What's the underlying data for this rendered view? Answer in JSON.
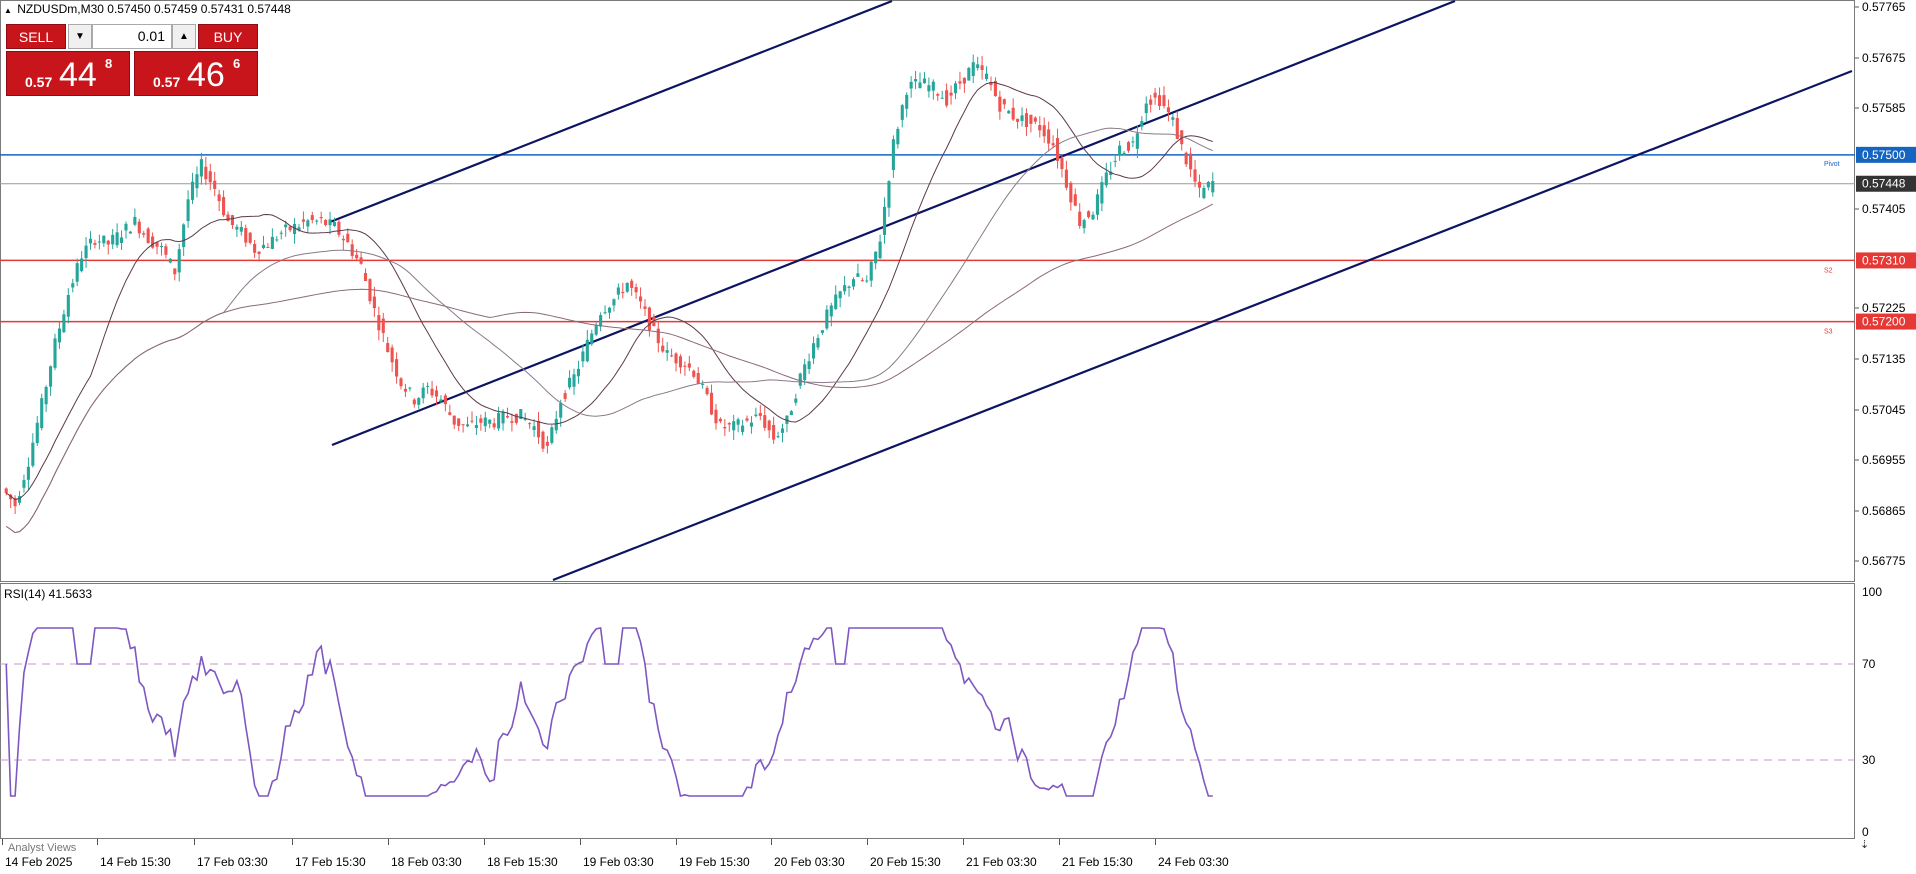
{
  "symbol_info": {
    "symbol": "NZDUSDm,M30",
    "ohlc": "0.57450 0.57459 0.57431 0.57448"
  },
  "trade_panel": {
    "sell_label": "SELL",
    "buy_label": "BUY",
    "lot": "0.01",
    "sell_prefix": "0.57",
    "sell_big": "44",
    "sell_sup": "8",
    "buy_prefix": "0.57",
    "buy_big": "46",
    "buy_sup": "6"
  },
  "price_axis": {
    "min": 0.56735,
    "max": 0.57775,
    "ticks": [
      "0.57765",
      "0.57675",
      "0.57585",
      "0.57405",
      "0.57225",
      "0.57135",
      "0.57045",
      "0.56955",
      "0.56865",
      "0.56775"
    ],
    "markers": [
      {
        "label": "0.57500",
        "price": 0.575,
        "color": "#1565c0"
      },
      {
        "label": "0.57448",
        "price": 0.57448,
        "color": "#333333"
      },
      {
        "label": "0.57310",
        "price": 0.5731,
        "color": "#e53935"
      },
      {
        "label": "0.57200",
        "price": 0.572,
        "color": "#e53935"
      }
    ]
  },
  "levels": [
    {
      "name": "pivot",
      "label": "Pivot",
      "price": 0.575,
      "color": "#1565c0"
    },
    {
      "name": "s2",
      "label": "S2",
      "price": 0.5731,
      "color": "#e53935"
    },
    {
      "name": "s3",
      "label": "S3",
      "price": 0.572,
      "color": "#e53935"
    }
  ],
  "bid_line": {
    "price": 0.57448,
    "color": "#999999"
  },
  "rsi": {
    "title": "RSI(14) 41.5633",
    "ticks": [
      "100",
      "70",
      "30",
      "0"
    ],
    "levels": [
      70,
      30
    ]
  },
  "time_axis": [
    "14 Feb 2025",
    "14 Feb 15:30",
    "17 Feb 03:30",
    "17 Feb 15:30",
    "18 Feb 03:30",
    "18 Feb 15:30",
    "19 Feb 03:30",
    "19 Feb 15:30",
    "20 Feb 03:30",
    "20 Feb 15:30",
    "21 Feb 03:30",
    "21 Feb 15:30",
    "24 Feb 03:30"
  ],
  "analyst_label": "Analyst Views",
  "colors": {
    "bull": "#26a69a",
    "bear": "#ef5350",
    "channel": "#0d1461",
    "ma": "#8a6a7a",
    "rsi": "#7e57c2"
  },
  "chart_data": {
    "type": "candlestick",
    "close_path": [
      0.569,
      0.5687,
      0.5695,
      0.5705,
      0.5716,
      0.5725,
      0.5732,
      0.5735,
      0.5734,
      0.5736,
      0.5738,
      0.5735,
      0.5733,
      0.5729,
      0.5742,
      0.5748,
      0.5744,
      0.5738,
      0.5736,
      0.5733,
      0.5734,
      0.5736,
      0.5737,
      0.5738,
      0.5738,
      0.5737,
      0.5734,
      0.573,
      0.5722,
      0.5715,
      0.5709,
      0.5706,
      0.5708,
      0.5706,
      0.5702,
      0.5701,
      0.5702,
      0.5702,
      0.5703,
      0.5703,
      0.5701,
      0.5697,
      0.5706,
      0.571,
      0.5716,
      0.5722,
      0.5724,
      0.5727,
      0.5723,
      0.5718,
      0.5714,
      0.5713,
      0.5711,
      0.5706,
      0.5701,
      0.5701,
      0.5702,
      0.5703,
      0.5699,
      0.5702,
      0.571,
      0.5716,
      0.5721,
      0.5725,
      0.5728,
      0.5727,
      0.5735,
      0.5752,
      0.5762,
      0.5763,
      0.5762,
      0.576,
      0.5763,
      0.5766,
      0.5764,
      0.5759,
      0.5757,
      0.5756,
      0.5755,
      0.5752,
      0.5745,
      0.5738,
      0.574,
      0.5746,
      0.5751,
      0.5752,
      0.576,
      0.576,
      0.5756,
      0.5749,
      0.5743,
      0.5745
    ]
  }
}
